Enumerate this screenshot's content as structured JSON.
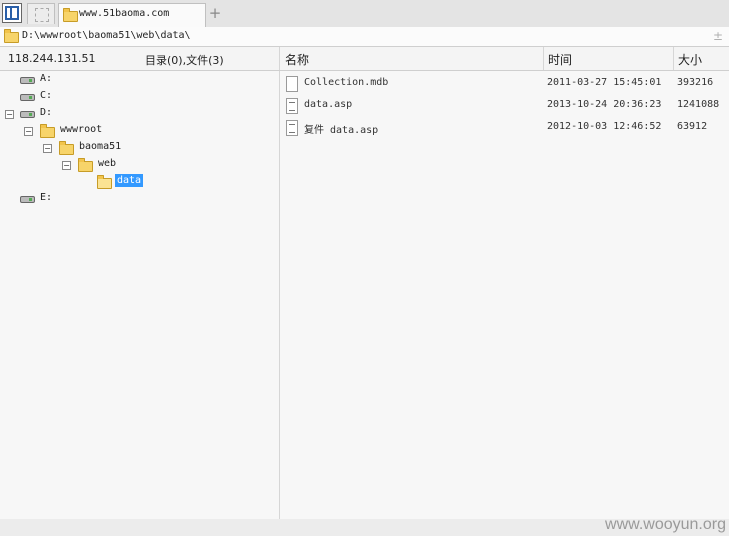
{
  "tab": {
    "title": "www.51baoma.com",
    "new_tab_symbol": "+"
  },
  "address": {
    "path": "D:\\wwwroot\\baoma51\\web\\data\\",
    "action_symbol": "±"
  },
  "status": {
    "ip": "118.244.131.51",
    "summary": "目录(0),文件(3)"
  },
  "columns": {
    "name": "名称",
    "time": "时间",
    "size": "大小"
  },
  "tree": [
    {
      "label": "A:",
      "icon": "drive-icon",
      "expander": ""
    },
    {
      "label": "C:",
      "icon": "drive-icon",
      "expander": ""
    },
    {
      "label": "D:",
      "icon": "drive-icon",
      "expander": "−"
    },
    {
      "label": "wwwroot",
      "icon": "folder-icon",
      "expander": "−"
    },
    {
      "label": "baoma51",
      "icon": "folder-icon",
      "expander": "−"
    },
    {
      "label": "web",
      "icon": "folder-icon",
      "expander": "−"
    },
    {
      "label": "data",
      "icon": "open-folder-icon",
      "expander": "",
      "selected": true
    },
    {
      "label": "E:",
      "icon": "drive-icon",
      "expander": ""
    }
  ],
  "files": [
    {
      "name": "Collection.mdb",
      "time": "2011-03-27 15:45:01",
      "size": "393216",
      "icon": "blank-file-icon"
    },
    {
      "name": "data.asp",
      "time": "2013-10-24 20:36:23",
      "size": "1241088",
      "icon": "script-file-icon"
    },
    {
      "name": "复件 data.asp",
      "time": "2012-10-03 12:46:52",
      "size": "63912",
      "icon": "script-file-icon"
    }
  ],
  "watermark": "www.wooyun.org",
  "colors": {
    "selection": "#3399ff",
    "folder": "#f7d46a",
    "background": "#f7f7f7"
  }
}
